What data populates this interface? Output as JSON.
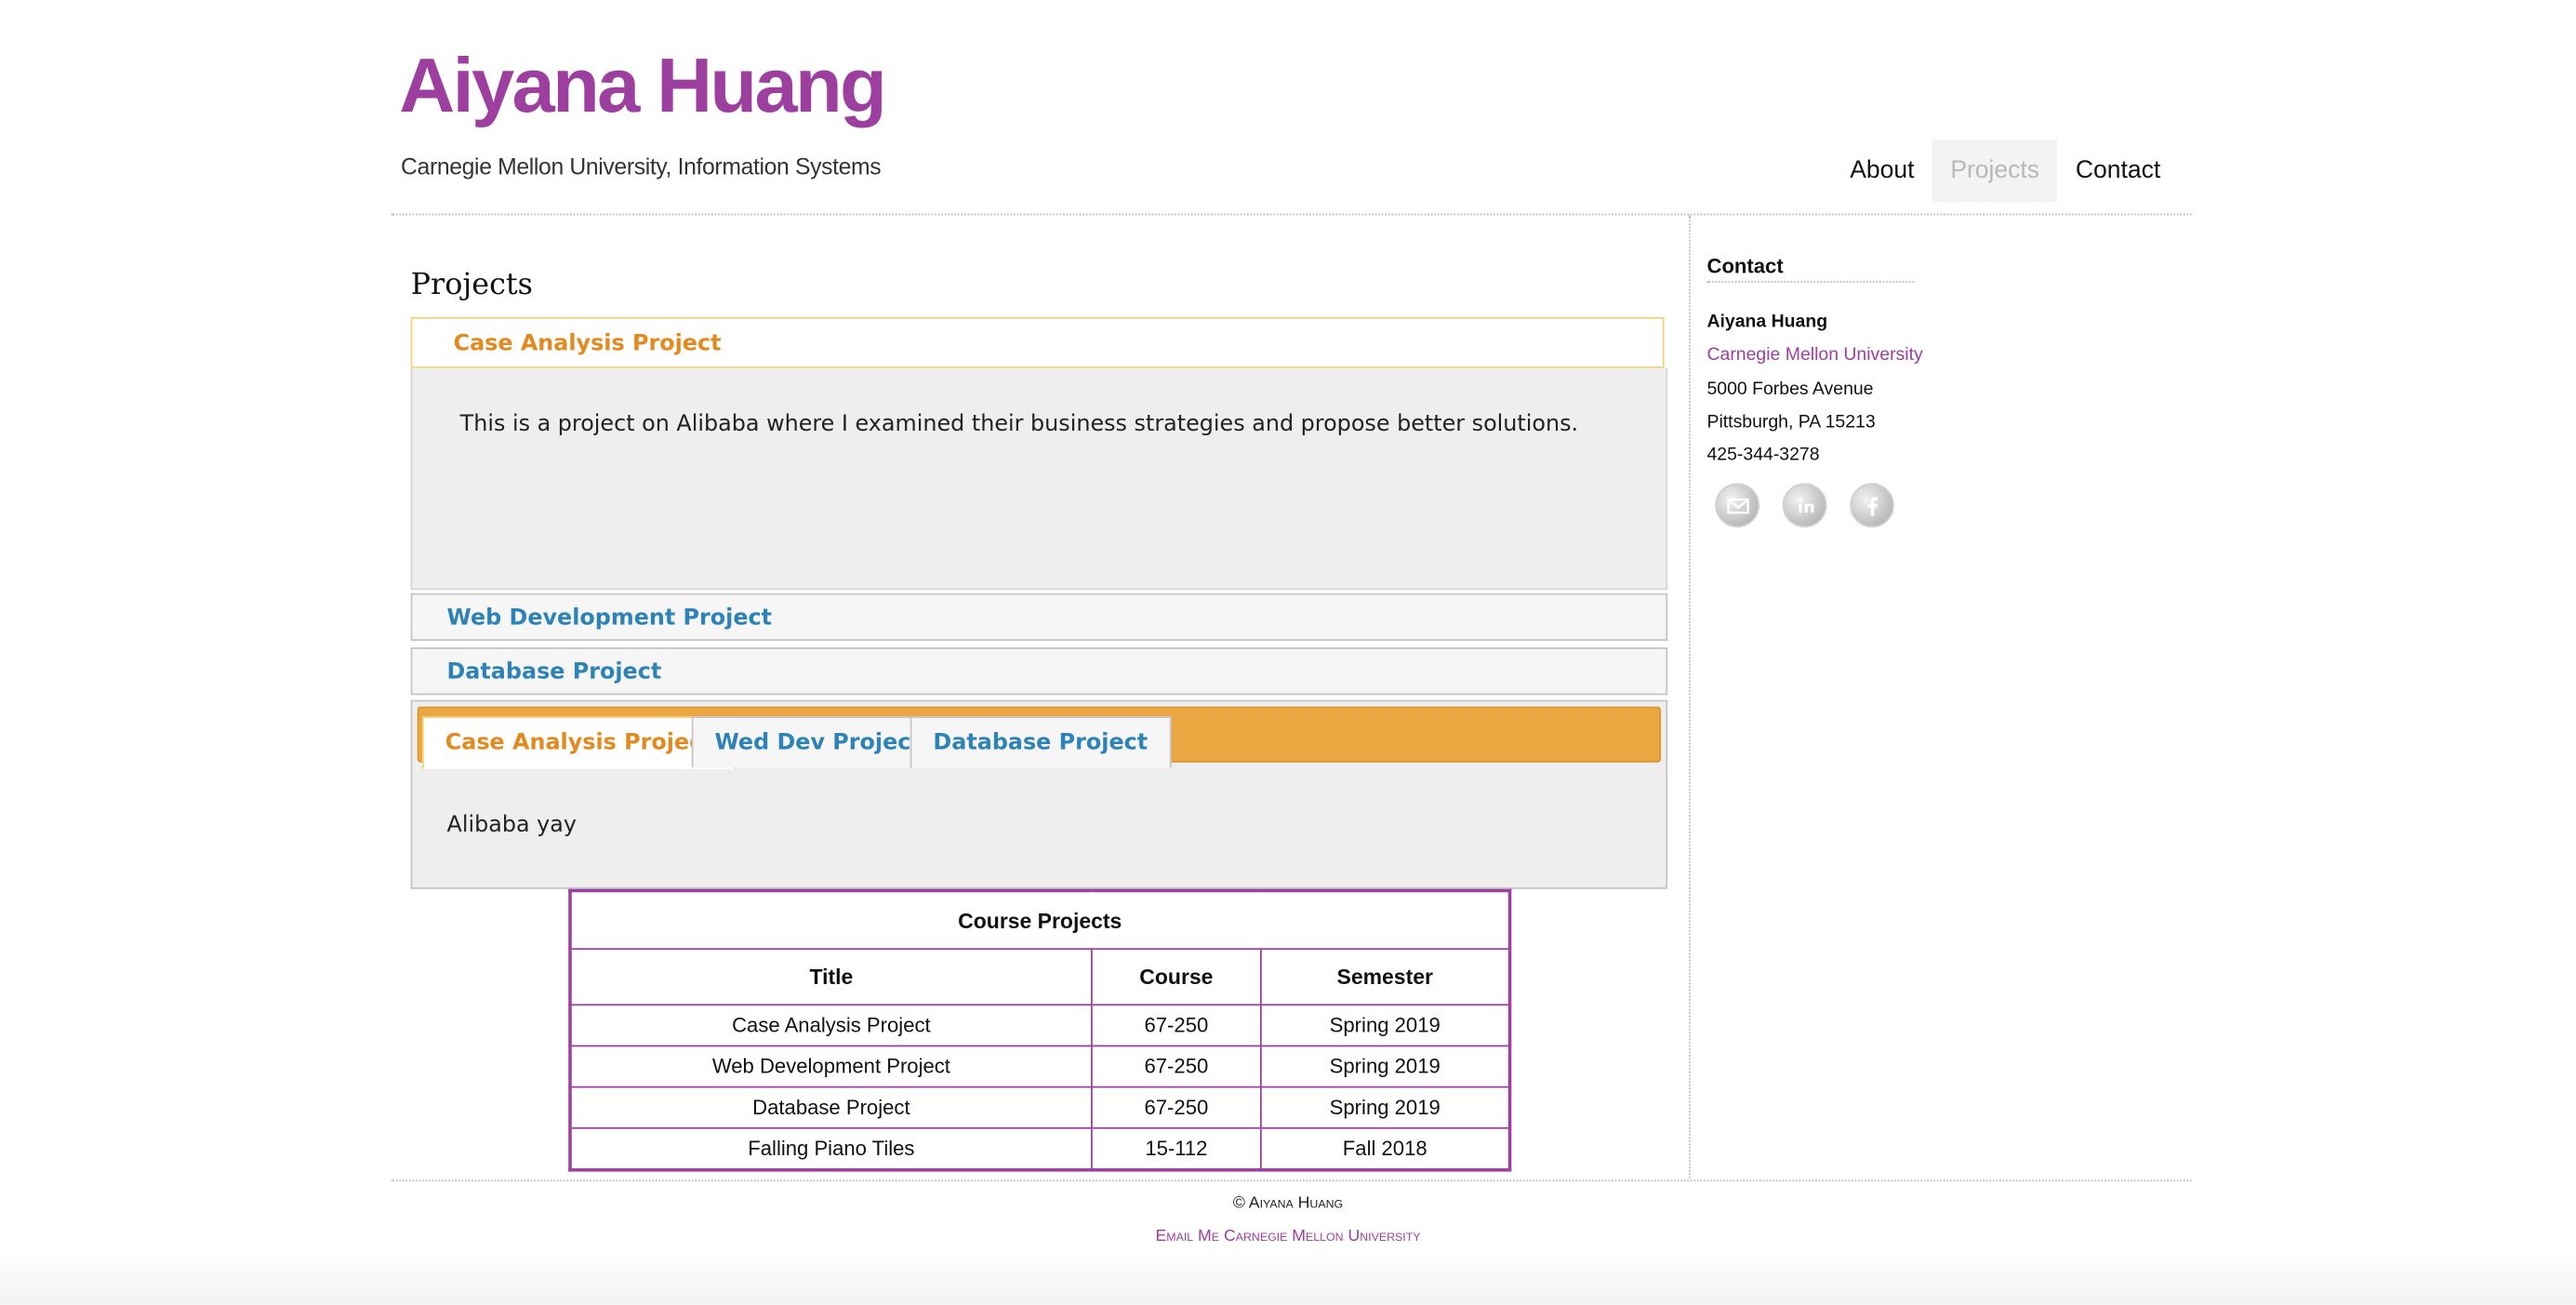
{
  "site": {
    "title": "Aiyana Huang",
    "tagline": "Carnegie Mellon University, Information Systems",
    "accent_color": "#9c3f9f"
  },
  "nav": {
    "items": [
      {
        "label": "About"
      },
      {
        "label": "Projects",
        "active": true
      },
      {
        "label": "Contact"
      }
    ]
  },
  "main": {
    "heading": "Projects",
    "accordion": [
      {
        "label": "Case Analysis Project",
        "active": true,
        "content": "This is a project on Alibaba where I examined their business strategies and propose better solutions."
      },
      {
        "label": "Web Development Project"
      },
      {
        "label": "Database Project"
      }
    ],
    "tabs": {
      "items": [
        {
          "label": "Case Analysis Project",
          "active": true
        },
        {
          "label": "Wed Dev Project"
        },
        {
          "label": "Database Project"
        }
      ],
      "content": "Alibaba yay",
      "bar_color": "#eba842"
    },
    "table": {
      "caption": "Course Projects",
      "headers": [
        "Title",
        "Course",
        "Semester"
      ],
      "rows": [
        [
          "Case Analysis Project",
          "67-250",
          "Spring 2019"
        ],
        [
          "Web Development Project",
          "67-250",
          "Spring 2019"
        ],
        [
          "Database Project",
          "67-250",
          "Spring 2019"
        ],
        [
          "Falling Piano Tiles",
          "15-112",
          "Fall 2018"
        ]
      ]
    }
  },
  "sidebar": {
    "title": "Contact",
    "name": "Aiyana Huang",
    "university": "Carnegie Mellon University",
    "address1": "5000 Forbes Avenue",
    "address2": "Pittsburgh, PA 15213",
    "phone": "425-344-3278",
    "social_icons": [
      "email-icon",
      "linkedin-icon",
      "facebook-icon"
    ]
  },
  "footer": {
    "copyright": "© Aiyana Huang",
    "email_link": "Email Me",
    "university_link": "Carnegie Mellon University"
  }
}
